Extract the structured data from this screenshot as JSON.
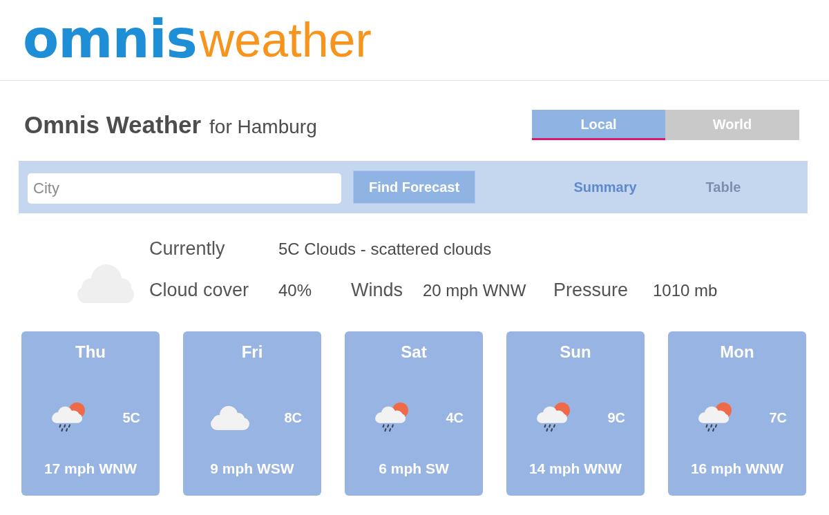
{
  "logo": {
    "wordmark": "omnis",
    "word": "weather"
  },
  "title": {
    "name": "Omnis Weather",
    "location": "for Hamburg"
  },
  "tabs": [
    {
      "label": "Local",
      "selected": true
    },
    {
      "label": "World",
      "selected": false
    }
  ],
  "search": {
    "placeholder": "City",
    "button": "Find Forecast"
  },
  "view_tabs": [
    {
      "label": "Summary",
      "selected": true
    },
    {
      "label": "Table",
      "selected": false
    }
  ],
  "current": {
    "label": "Currently",
    "value": "5C Clouds - scattered clouds",
    "details": [
      {
        "label": "Cloud cover",
        "value": "40%"
      },
      {
        "label": "Winds",
        "value": "20 mph WNW"
      },
      {
        "label": "Pressure",
        "value": "1010 mb"
      }
    ]
  },
  "forecast": [
    {
      "day": "Thu",
      "kind": "rain",
      "temp": "5C",
      "wind": "17 mph WNW"
    },
    {
      "day": "Fri",
      "kind": "cloud",
      "temp": "8C",
      "wind": "9 mph WSW"
    },
    {
      "day": "Sat",
      "kind": "rain",
      "temp": "4C",
      "wind": "6 mph SW"
    },
    {
      "day": "Sun",
      "kind": "rain",
      "temp": "9C",
      "wind": "14 mph WNW"
    },
    {
      "day": "Mon",
      "kind": "rain",
      "temp": "7C",
      "wind": "16 mph WNW"
    }
  ]
}
